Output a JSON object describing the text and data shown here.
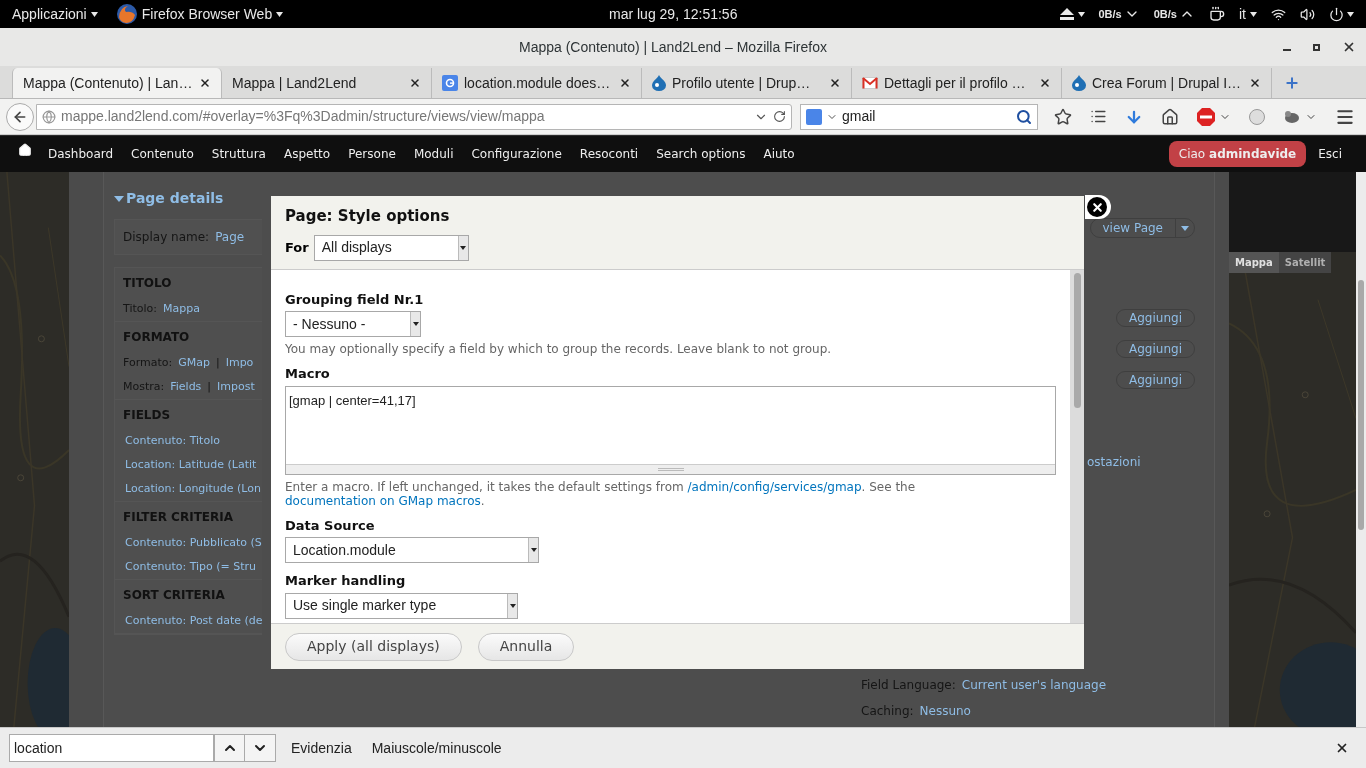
{
  "topbar": {
    "apps": "Applicazioni",
    "app_name": "Firefox Browser Web",
    "clock": "mar lug 29, 12:51:56",
    "net_down": "0B/s",
    "net_up": "0B/s",
    "language": "it"
  },
  "window": {
    "title": "Mappa (Contenuto) | Land2Lend – Mozilla Firefox"
  },
  "tabs": [
    {
      "label": "Mappa (Contenuto) | Lan…",
      "kind": "none",
      "selected": true
    },
    {
      "label": "Mappa | Land2Lend",
      "kind": "none",
      "selected": false
    },
    {
      "label": "location.module does…",
      "kind": "google",
      "selected": false
    },
    {
      "label": "Profilo utente | Drup…",
      "kind": "drupal",
      "selected": false
    },
    {
      "label": "Dettagli per il profilo …",
      "kind": "gmail",
      "selected": false
    },
    {
      "label": "Crea Forum | Drupal I…",
      "kind": "drupal",
      "selected": false
    }
  ],
  "nav": {
    "url": "mappe.land2lend.com/#overlay=%3Fq%3Dadmin/structure/views/view/mappa",
    "search": "gmail"
  },
  "toolbar": {
    "items": [
      "Dashboard",
      "Contenuto",
      "Struttura",
      "Aspetto",
      "Persone",
      "Moduli",
      "Configurazione",
      "Resoconti",
      "Search options",
      "Aiuto"
    ],
    "greeting": "Ciao **admindavide**",
    "logout": "Esci"
  },
  "page": {
    "title": "Page details",
    "display_name_label": "Display name:",
    "display_name": "Page",
    "view_button": "view Page",
    "sections": [
      {
        "heading": "TITOLO",
        "rows": [
          {
            "label": "Titolo:",
            "links": [
              "Mappa"
            ]
          }
        ]
      },
      {
        "heading": "FORMATO",
        "rows": [
          {
            "label": "Formato:",
            "links": [
              "GMap",
              "Impo"
            ],
            "separator": "|"
          },
          {
            "label": "Mostra:",
            "links": [
              "Fields",
              "Impost"
            ],
            "separator": "|"
          }
        ]
      },
      {
        "heading": "FIELDS",
        "rows": [
          {
            "links": [
              "Contenuto: Titolo"
            ]
          },
          {
            "links": [
              "Location: Latitude (Latit"
            ]
          },
          {
            "links": [
              "Location: Longitude (Lon"
            ]
          }
        ]
      },
      {
        "heading": "FILTER CRITERIA",
        "rows": [
          {
            "links": [
              "Contenuto: Pubblicato (S"
            ]
          },
          {
            "links": [
              "Contenuto: Tipo (= Stru"
            ]
          }
        ]
      },
      {
        "heading": "SORT CRITERIA",
        "rows": [
          {
            "links": [
              "Contenuto: Post date (de"
            ]
          }
        ]
      }
    ],
    "add_buttons": [
      "Aggiungi",
      "Aggiungi",
      "Aggiungi"
    ],
    "partial_link": "ostazioni",
    "details": [
      {
        "label": "Field Language:",
        "value": "Current user's language"
      },
      {
        "label": "Caching:",
        "value": "Nessuno"
      }
    ]
  },
  "map": {
    "map_button": "Mappa",
    "satellite_button": "Satellit"
  },
  "dialog": {
    "title": "Page: Style options",
    "for_label": "For",
    "for_value": "All displays",
    "fields": [
      {
        "kind": "select",
        "label": "Grouping field Nr.1",
        "value": "- Nessuno -",
        "help": [
          {
            "kind": "text",
            "text": "You may optionally specify a field by which to group the records. Leave blank to not group."
          }
        ]
      },
      {
        "kind": "textarea",
        "label": "Macro",
        "value": "[gmap | center=41,17]",
        "help": [
          {
            "kind": "text",
            "text": "Enter a macro. If left unchanged, it takes the default settings from "
          },
          {
            "kind": "link",
            "text": "/admin/config/services/gmap"
          },
          {
            "kind": "text",
            "text": ". See the "
          },
          {
            "kind": "link",
            "text": "documentation on GMap macros"
          },
          {
            "kind": "text",
            "text": "."
          }
        ]
      },
      {
        "kind": "select",
        "label": "Data Source",
        "value": "Location.module"
      },
      {
        "kind": "select",
        "label": "Marker handling",
        "value": "Use single marker type"
      }
    ],
    "buttons": [
      "Apply (all displays)",
      "Annulla"
    ]
  },
  "findbar": {
    "query": "location",
    "highlight": "Evidenzia",
    "match_case": "Maiuscole/minuscole"
  }
}
